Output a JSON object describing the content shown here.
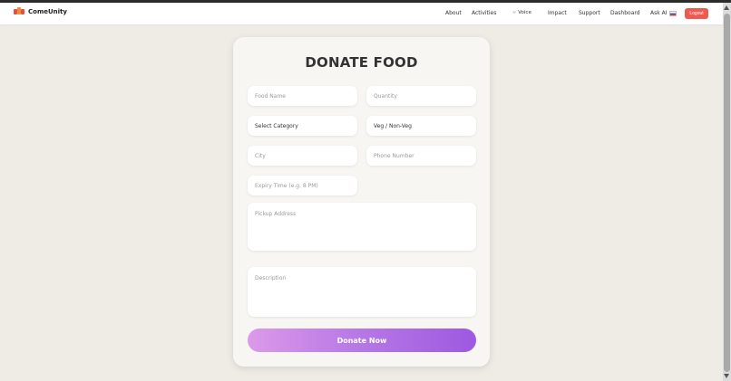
{
  "brand": {
    "name": "ComeUnity",
    "logo_icon": "bars-logo-icon"
  },
  "nav": {
    "about": "About",
    "activities": "Activities",
    "voice": "Voice",
    "voice_icon": "sound-wave-icon",
    "impact": "Impact",
    "support": "Support",
    "dashboard": "Dashboard",
    "ask_ai": "Ask AI",
    "ask_ai_icon": "flag-icon",
    "logout": "Logout"
  },
  "form": {
    "title": "DONATE FOOD",
    "food_name_placeholder": "Food Name",
    "quantity_placeholder": "Quantity",
    "category_value": "Select Category",
    "veg_value": "Veg / Non-Veg",
    "city_placeholder": "City",
    "phone_placeholder": "Phone Number",
    "expiry_placeholder": "Expiry Time (e.g. 8 PM)",
    "pickup_placeholder": "Pickup Address",
    "description_placeholder": "Description",
    "submit_label": "Donate Now"
  },
  "colors": {
    "accent_button_start": "#dc9ae8",
    "accent_button_end": "#9d59e0",
    "logout": "#ef5a50",
    "background": "#efece6"
  }
}
